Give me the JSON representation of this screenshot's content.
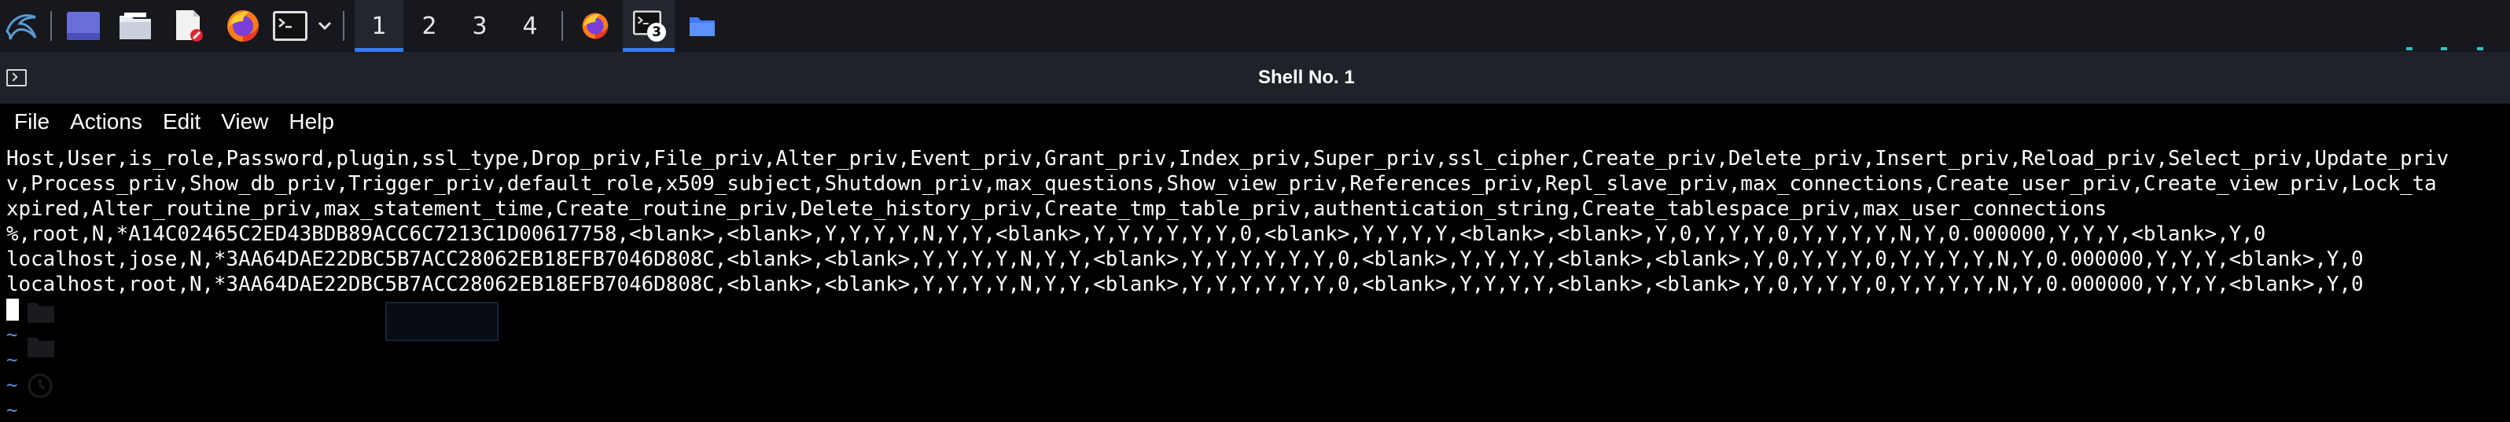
{
  "panel": {
    "workspaces": [
      "1",
      "2",
      "3",
      "4"
    ],
    "active_workspace": "1",
    "terminal_badge": "3",
    "colors": {
      "background": "#16181d",
      "accent": "#367bf0"
    },
    "launchers": [
      "kali-menu-icon",
      "desktop-window-icon",
      "file-manager-icon",
      "text-editor-icon",
      "firefox-icon",
      "terminal-icon",
      "chevron-down-icon"
    ],
    "tasks": [
      "firefox-icon",
      "terminal-icon",
      "folder-icon"
    ]
  },
  "window": {
    "title": "Shell No. 1"
  },
  "menu": {
    "items": [
      "File",
      "Actions",
      "Edit",
      "View",
      "Help"
    ]
  },
  "terminal": {
    "lines": [
      "Host,User,is_role,Password,plugin,ssl_type,Drop_priv,File_priv,Alter_priv,Event_priv,Grant_priv,Index_priv,Super_priv,ssl_cipher,Create_priv,Delete_priv,Insert_priv,Reload_priv,Select_priv,Update_priv",
      "v,Process_priv,Show_db_priv,Trigger_priv,default_role,x509_subject,Shutdown_priv,max_questions,Show_view_priv,References_priv,Repl_slave_priv,max_connections,Create_user_priv,Create_view_priv,Lock_ta",
      "xpired,Alter_routine_priv,max_statement_time,Create_routine_priv,Delete_history_priv,Create_tmp_table_priv,authentication_string,Create_tablespace_priv,max_user_connections",
      "%,root,N,*A14C02465C2ED43BDB89ACC6C7213C1D00617758,<blank>,<blank>,Y,Y,Y,Y,N,Y,Y,<blank>,Y,Y,Y,Y,Y,Y,0,<blank>,Y,Y,Y,Y,<blank>,<blank>,Y,0,Y,Y,Y,0,Y,Y,Y,Y,N,Y,0.000000,Y,Y,Y,<blank>,Y,0",
      "localhost,jose,N,*3AA64DAE22DBC5B7ACC28062EB18EFB7046D808C,<blank>,<blank>,Y,Y,Y,Y,N,Y,Y,<blank>,Y,Y,Y,Y,Y,Y,0,<blank>,Y,Y,Y,Y,<blank>,<blank>,Y,0,Y,Y,Y,0,Y,Y,Y,Y,N,Y,0.000000,Y,Y,Y,<blank>,Y,0",
      "localhost,root,N,*3AA64DAE22DBC5B7ACC28062EB18EFB7046D808C,<blank>,<blank>,Y,Y,Y,Y,N,Y,Y,<blank>,Y,Y,Y,Y,Y,Y,0,<blank>,Y,Y,Y,Y,<blank>,<blank>,Y,0,Y,Y,Y,0,Y,Y,Y,Y,N,Y,0.000000,Y,Y,Y,<blank>,Y,0"
    ],
    "tilde": "~",
    "colors": {
      "text": "#ffffff",
      "tilde": "#5a8fd8",
      "background": "#000000"
    }
  }
}
